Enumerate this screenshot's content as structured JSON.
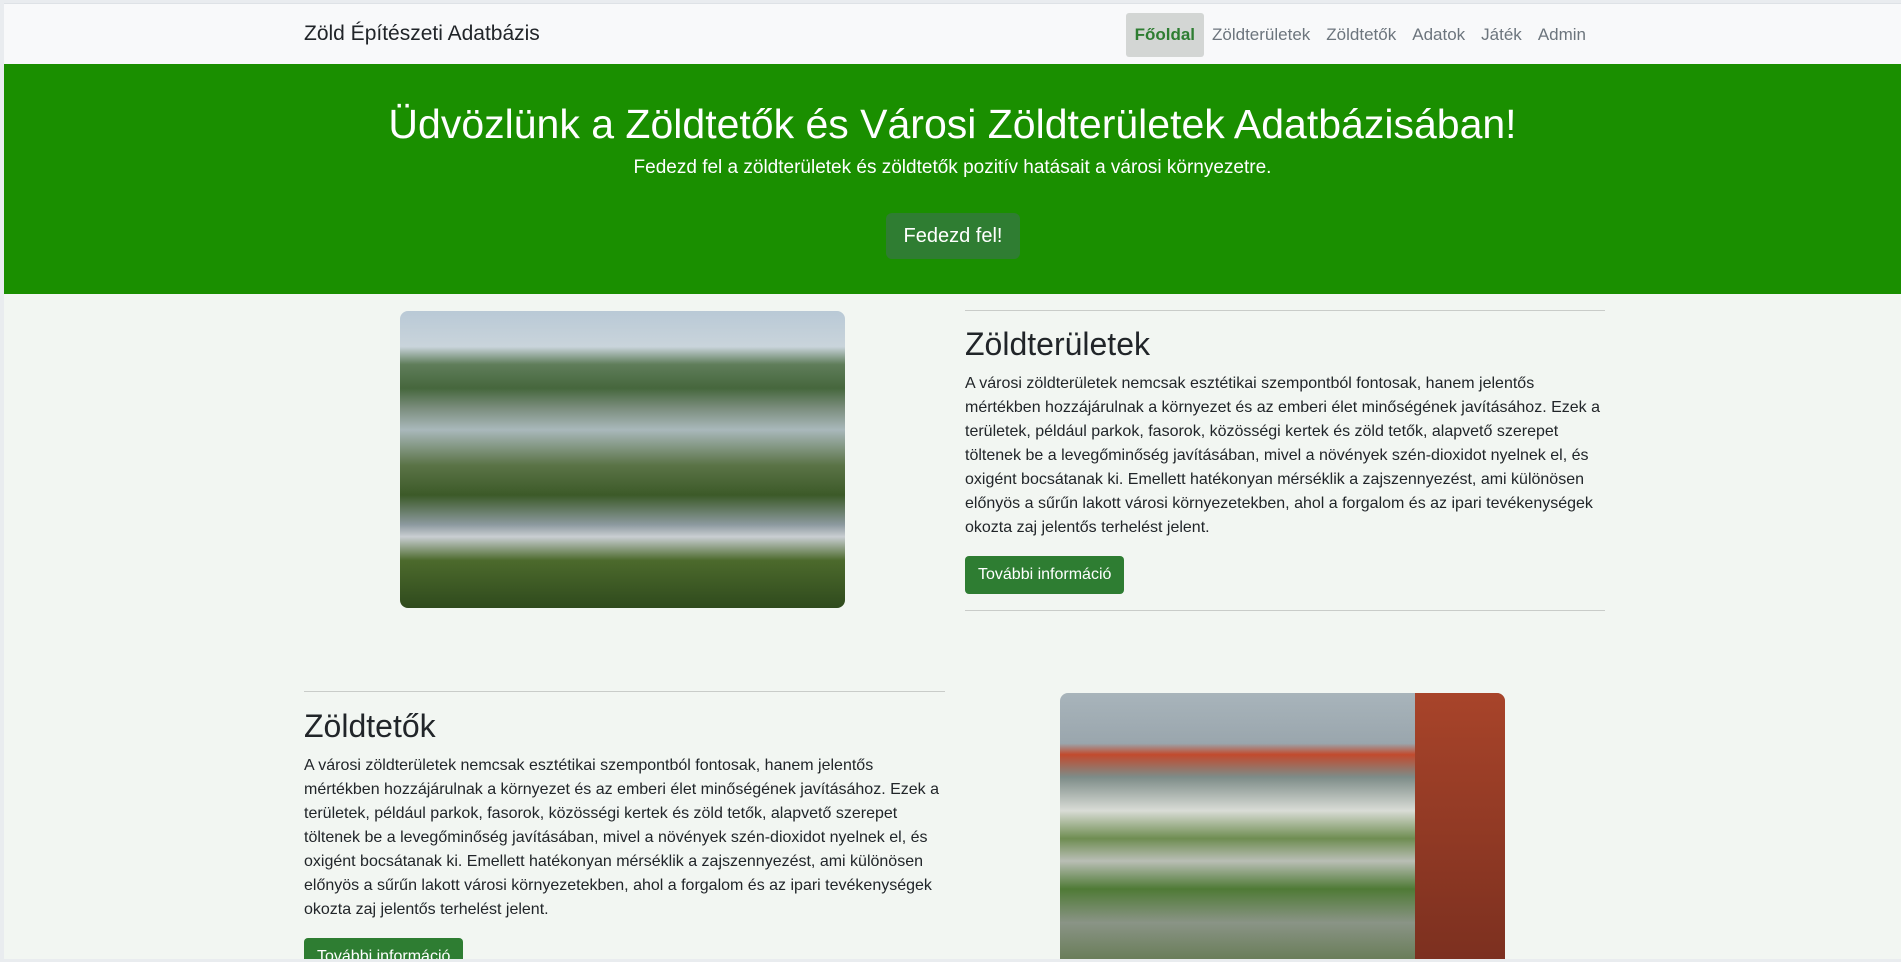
{
  "navbar": {
    "brand": "Zöld Építészeti Adatbázis",
    "items": [
      {
        "label": "Főoldal",
        "active": true
      },
      {
        "label": "Zöldterületek",
        "active": false
      },
      {
        "label": "Zöldtetők",
        "active": false
      },
      {
        "label": "Adatok",
        "active": false
      },
      {
        "label": "Játék",
        "active": false
      },
      {
        "label": "Admin",
        "active": false
      }
    ]
  },
  "hero": {
    "title": "Üdvözlünk a Zöldtetők és Városi Zöldterületek Adatbázisában!",
    "subtitle": "Fedezd fel a zöldterületek és zöldtetők pozitív hatásait a városi környezetre.",
    "button_label": "Fedezd fel!"
  },
  "sections": [
    {
      "title": "Zöldterületek",
      "text": "A városi zöldterületek nemcsak esztétikai szempontból fontosak, hanem jelentős mértékben hozzájárulnak a környezet és az emberi élet minőségének javításához. Ezek a területek, például parkok, fasorok, közösségi kertek és zöld tetők, alapvető szerepet töltenek be a levegőminőség javításában, mivel a növények szén-dioxidot nyelnek el, és oxigént bocsátanak ki. Emellett hatékonyan mérséklik a zajszennyezést, ami különösen előnyös a sűrűn lakott városi környezetekben, ahol a forgalom és az ipari tevékenységek okozta zaj jelentős terhelést jelent.",
      "button_label": "További információ"
    },
    {
      "title": "Zöldtetők",
      "text": "A városi zöldterületek nemcsak esztétikai szempontból fontosak, hanem jelentős mértékben hozzájárulnak a környezet és az emberi élet minőségének javításához. Ezek a területek, például parkok, fasorok, közösségi kertek és zöld tetők, alapvető szerepet töltenek be a levegőminőség javításában, mivel a növények szén-dioxidot nyelnek el, és oxigént bocsátanak ki. Emellett hatékonyan mérséklik a zajszennyezést, ami különösen előnyös a sűrűn lakott városi környezetekben, ahol a forgalom és az ipari tevékenységek okozta zaj jelentős terhelést jelent.",
      "button_label": "További információ"
    }
  ],
  "colors": {
    "hero_bg": "#1a8f00",
    "button_green": "#2e7d32",
    "page_bg": "#f2f6f2"
  }
}
